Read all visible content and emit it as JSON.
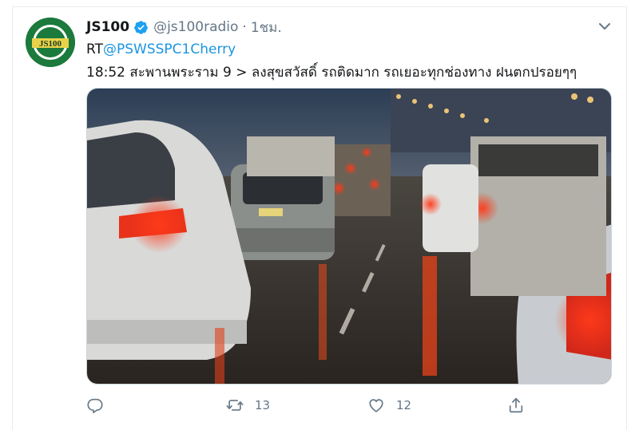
{
  "tweet": {
    "display_name": "JS100",
    "handle": "@js100radio",
    "separator": "·",
    "time": "1ชม.",
    "avatar_text": "JS100",
    "rt_prefix": "RT",
    "rt_mention": "@PSWSSPC1Cherry",
    "body": "18:52 สะพานพระราม 9 > ลงสุขสวัสดิ์ รถติดมาก รถเยอะทุกช่องทาง ฝนตกปรอยๆๆ"
  },
  "actions": {
    "reply_count": "",
    "retweet_count": "13",
    "like_count": "12"
  },
  "icons": {
    "avatar": "js100-logo",
    "verified": "verified-badge-icon",
    "more": "chevron-down-icon",
    "reply": "reply-icon",
    "retweet": "retweet-icon",
    "like": "heart-icon",
    "share": "share-icon"
  },
  "colors": {
    "accent": "#1b95e0",
    "text": "#14171a",
    "muted": "#657786",
    "logo_green": "#1b7a3c"
  }
}
